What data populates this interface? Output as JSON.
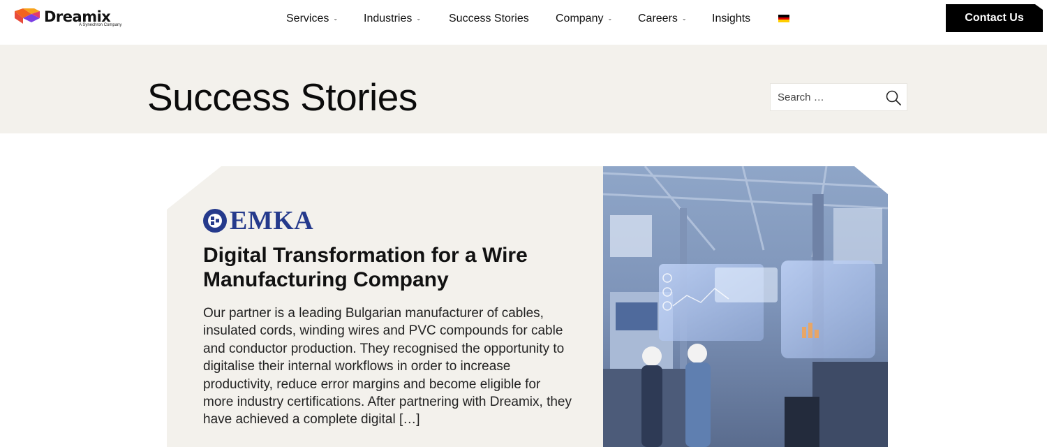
{
  "header": {
    "logo": {
      "word": "Dreamix",
      "tagline": "A Synechron Company"
    },
    "nav": [
      {
        "label": "Services",
        "has_dropdown": true
      },
      {
        "label": "Industries",
        "has_dropdown": true
      },
      {
        "label": "Success Stories",
        "has_dropdown": false
      },
      {
        "label": "Company",
        "has_dropdown": true
      },
      {
        "label": "Careers",
        "has_dropdown": true
      },
      {
        "label": "Insights",
        "has_dropdown": false
      }
    ],
    "language_flag": "germany-flag-icon",
    "contact_label": "Contact Us"
  },
  "hero": {
    "title": "Success Stories",
    "search": {
      "placeholder": "Search …",
      "value": ""
    }
  },
  "story": {
    "client_logo_text": "EMKA",
    "title": "Digital Transformation for a Wire Manufacturing Company",
    "excerpt": "Our partner is a leading Bulgarian manufacturer of cables, insulated cords, winding wires and PVC compounds for cable and conductor production. They recognised the opportunity to digitalise their internal workflows in order to increase productivity, reduce error margins and become eligible for more industry certifications. After partnering with Dreamix, they have achieved a complete digital […]",
    "image": "factory-engineers-hologram-photo"
  },
  "colors": {
    "hero_bg": "#f3f1ec",
    "card_bg": "#f3f1ec",
    "button_bg": "#000000",
    "emka_blue": "#253a8c"
  }
}
